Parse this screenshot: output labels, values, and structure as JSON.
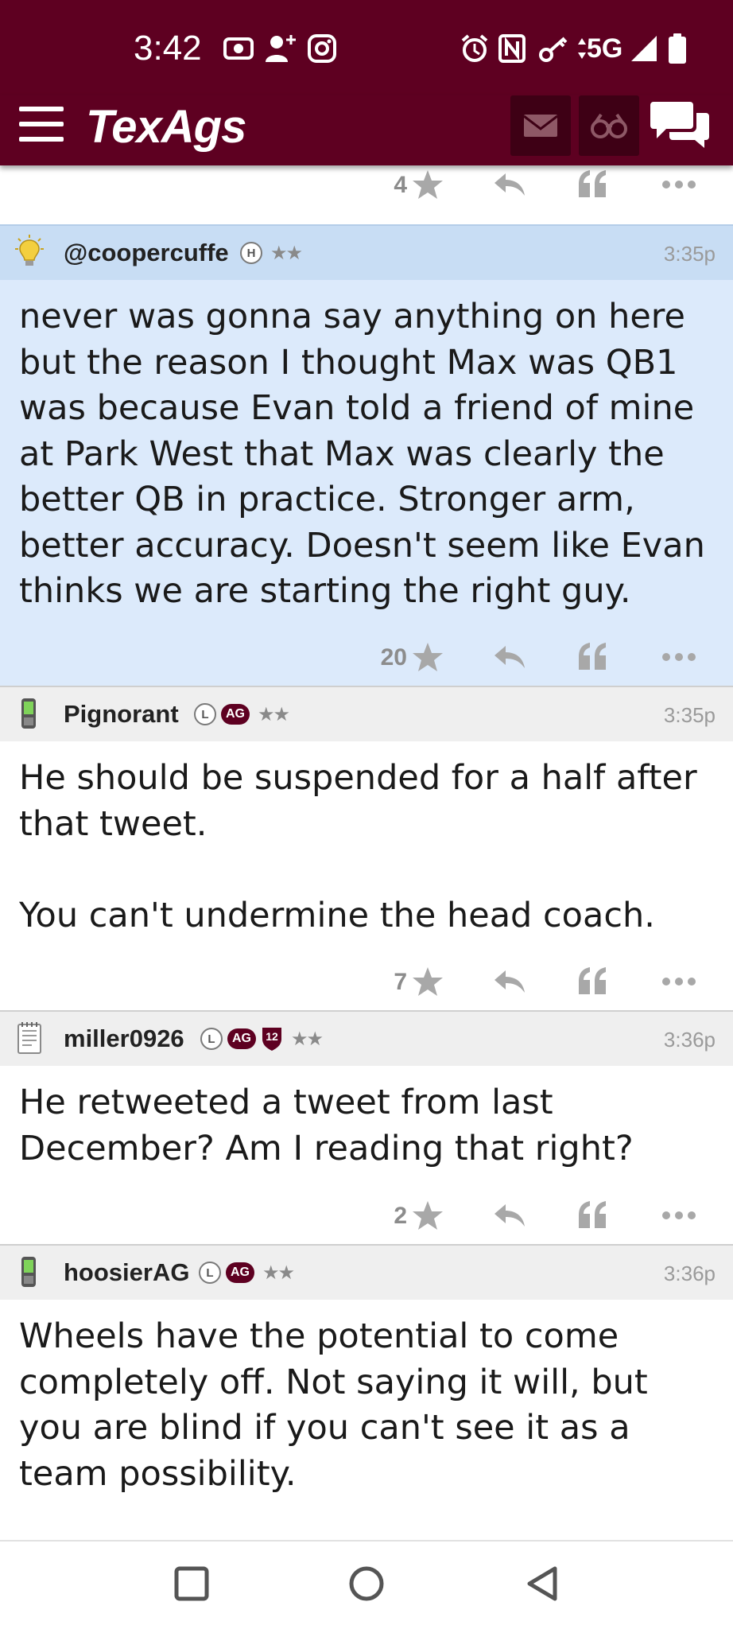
{
  "status_bar": {
    "time": "3:42",
    "network": "5G",
    "left_icons": [
      "screen-record-icon",
      "person-add-icon",
      "instagram-icon"
    ],
    "right_icons": [
      "alarm-icon",
      "nfc-icon",
      "key-icon",
      "data-arrows-icon",
      "signal-icon",
      "battery-icon"
    ]
  },
  "app_bar": {
    "logo": "TexAgs",
    "brand_color": "#5e0021",
    "icons": [
      "menu-icon",
      "mail-icon",
      "binoculars-icon",
      "chat-icon"
    ]
  },
  "top_actions": {
    "star_count": "4"
  },
  "posts": [
    {
      "username": "@coopercuffe",
      "badges": [
        "H"
      ],
      "time": "3:35p",
      "body": "never was gonna say anything on here but the reason I thought Max was QB1 was because Evan told a friend of mine at Park West that Max was clearly the better QB in practice. Stronger arm, better accuracy. Doesn't seem like Evan thinks we are starting the right guy.",
      "star_count": "20",
      "avatar": "lightbulb-icon",
      "highlighted": true
    },
    {
      "username": "Pignorant",
      "badges": [
        "L",
        "AG"
      ],
      "time": "3:35p",
      "body": "He should be suspended for a half after that tweet.\n\nYou can't undermine the head coach.",
      "star_count": "7",
      "avatar": "phone-icon",
      "highlighted": false
    },
    {
      "username": "miller0926",
      "badges": [
        "L",
        "AG",
        "12"
      ],
      "time": "3:36p",
      "body": "He retweeted a tweet from last December? Am I reading that right?",
      "star_count": "2",
      "avatar": "notepad-icon",
      "highlighted": false
    },
    {
      "username": "hoosierAG",
      "badges": [
        "L",
        "AG"
      ],
      "time": "3:36p",
      "body": "Wheels have the potential to come completely off. Not saying it will, but you are blind if you can't see it as a team possibility.",
      "avatar": "phone-icon",
      "highlighted": false
    }
  ],
  "nav_bar": {
    "icons": [
      "recents-icon",
      "home-icon",
      "back-icon"
    ]
  }
}
